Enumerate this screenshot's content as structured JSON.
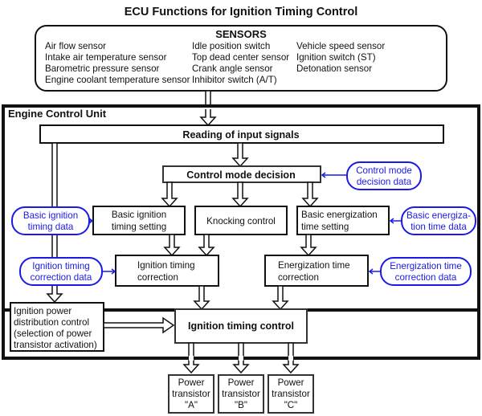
{
  "title": "ECU Functions for Ignition Timing Control",
  "sensors": {
    "header": "SENSORS",
    "columns": [
      [
        "Air flow sensor",
        "Intake air temperature sensor",
        "Barometric pressure sensor",
        "Engine coolant temperature sensor"
      ],
      [
        "Idle position switch",
        "Top dead center sensor",
        "Crank angle sensor",
        "Inhibitor switch (A/T)"
      ],
      [
        "Vehicle speed sensor",
        "Ignition switch (ST)",
        "Detonation sensor"
      ]
    ]
  },
  "ecu": {
    "label": "Engine Control Unit",
    "blocks": {
      "reading": "Reading of input signals",
      "control_mode": "Control mode decision",
      "basic_ignition": [
        "Basic ignition",
        "timing setting"
      ],
      "knocking": "Knocking control",
      "basic_energization": [
        "Basic energization",
        "time setting"
      ],
      "ignition_correction": [
        "Ignition timing",
        "correction"
      ],
      "energization_correction": [
        "Energization time",
        "correction"
      ],
      "power_distribution": [
        "Ignition power",
        "distribution control",
        "(selection of power",
        "transistor activation)"
      ],
      "ignition_control": "Ignition timing control"
    },
    "data_inputs": {
      "control_mode_data": [
        "Control mode",
        "decision data"
      ],
      "basic_ignition_data": [
        "Basic ignition",
        "timing data"
      ],
      "ignition_correction_data": [
        "Ignition timing",
        "correction data"
      ],
      "basic_energization_data": [
        "Basic energiza-",
        "tion time data"
      ],
      "energization_correction_data": [
        "Energization time",
        "correction data"
      ]
    }
  },
  "outputs": [
    [
      "Power",
      "transistor",
      "\"A\""
    ],
    [
      "Power",
      "transistor",
      "\"B\""
    ],
    [
      "Power",
      "transistor",
      "\"C\""
    ]
  ],
  "colors": {
    "line": "#111111",
    "data_accent": "#1a1ae6"
  }
}
